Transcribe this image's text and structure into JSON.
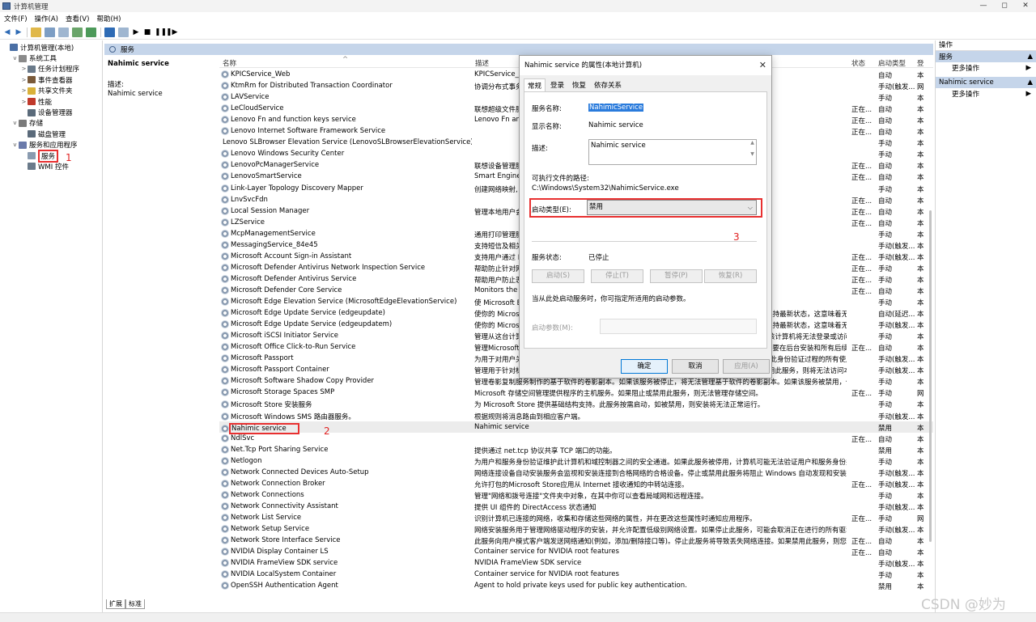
{
  "window": {
    "title": "计算机管理",
    "controls": [
      "—",
      "◻",
      "✕"
    ]
  },
  "menu": [
    "文件(F)",
    "操作(A)",
    "查看(V)",
    "帮助(H)"
  ],
  "tree": [
    {
      "label": "计算机管理(本地)",
      "level": 0,
      "exp": "",
      "color": "#4a6fa5"
    },
    {
      "label": "系统工具",
      "level": 1,
      "exp": "v",
      "color": "#8a8a8a"
    },
    {
      "label": "任务计划程序",
      "level": 2,
      "exp": ">",
      "color": "#6a7a8a"
    },
    {
      "label": "事件查看器",
      "level": 2,
      "exp": ">",
      "color": "#7a5a3a"
    },
    {
      "label": "共享文件夹",
      "level": 2,
      "exp": ">",
      "color": "#d9b13a"
    },
    {
      "label": "性能",
      "level": 2,
      "exp": ">",
      "color": "#c0392b"
    },
    {
      "label": "设备管理器",
      "level": 2,
      "exp": "",
      "color": "#5a6a7a"
    },
    {
      "label": "存储",
      "level": 1,
      "exp": "v",
      "color": "#7a7a7a"
    },
    {
      "label": "磁盘管理",
      "level": 2,
      "exp": "",
      "color": "#5a6a7a"
    },
    {
      "label": "服务和应用程序",
      "level": 1,
      "exp": "v",
      "color": "#6a7aaa"
    },
    {
      "label": "服务",
      "level": 2,
      "exp": "",
      "color": "#8a9bb0",
      "selected": true
    },
    {
      "label": "WMI 控件",
      "level": 2,
      "exp": "",
      "color": "#6a7a8a"
    }
  ],
  "annotations": {
    "a1": "1",
    "a2": "2",
    "a3": "3"
  },
  "mid": {
    "header": "服务",
    "desc_title": "Nahimic service",
    "desc_label": "描述:",
    "desc_text": "Nahimic service"
  },
  "columns": {
    "name": "名称",
    "sort": "^",
    "desc": "描述",
    "status": "状态",
    "type": "启动类型",
    "logon": "登"
  },
  "services": [
    {
      "n": "KPICService_Web",
      "d": "KPICService_W",
      "s": "",
      "t": "自动",
      "l": "本"
    },
    {
      "n": "KtmRm for Distributed Transaction Coordinator",
      "d": "协调分布式事务",
      "s": "",
      "t": "手动(触发...",
      "l": "网"
    },
    {
      "n": "LAVService",
      "d": "",
      "s": "",
      "t": "手动",
      "l": "本"
    },
    {
      "n": "LeCloudService",
      "d": "联想超级文件服",
      "s": "正在...",
      "t": "自动",
      "l": "本"
    },
    {
      "n": "Lenovo Fn and function keys service",
      "d": "Lenovo Fn and",
      "s": "正在...",
      "t": "自动",
      "l": "本"
    },
    {
      "n": "Lenovo Internet Software Framework Service",
      "d": "",
      "s": "正在...",
      "t": "自动",
      "l": "本"
    },
    {
      "n": "Lenovo SLBrowser Elevation Service (LenovoSLBrowserElevationService)",
      "d": "",
      "s": "",
      "t": "手动",
      "l": "本"
    },
    {
      "n": "Lenovo Windows Security Center",
      "d": "",
      "s": "",
      "t": "手动",
      "l": "本"
    },
    {
      "n": "LenovoPcManagerService",
      "d": "联想设备管理服",
      "s": "正在...",
      "t": "自动",
      "l": "本"
    },
    {
      "n": "LenovoSmartService",
      "d": "Smart Engine",
      "s": "正在...",
      "t": "自动",
      "l": "本"
    },
    {
      "n": "Link-Layer Topology Discovery Mapper",
      "d": "创建网络映射,",
      "s": "",
      "t": "手动",
      "l": "本"
    },
    {
      "n": "LnvSvcFdn",
      "d": "",
      "s": "正在...",
      "t": "自动",
      "l": "本"
    },
    {
      "n": "Local Session Manager",
      "d": "管理本地用户会",
      "s": "正在...",
      "t": "自动",
      "l": "本"
    },
    {
      "n": "LZService",
      "d": "",
      "s": "正在...",
      "t": "自动",
      "l": "本"
    },
    {
      "n": "McpManagementService",
      "d": "通用打印管理服",
      "s": "",
      "t": "手动",
      "l": "本"
    },
    {
      "n": "MessagingService_84e45",
      "d": "支持短信及相关",
      "s": "",
      "t": "手动(触发...",
      "l": "本"
    },
    {
      "n": "Microsoft Account Sign-in Assistant",
      "d": "支持用户通过 M",
      "s": "正在...",
      "t": "手动(触发...",
      "l": "本"
    },
    {
      "n": "Microsoft Defender Antivirus Network Inspection Service",
      "d": "帮助防止针对网",
      "s": "正在...",
      "t": "手动",
      "l": "本"
    },
    {
      "n": "Microsoft Defender Antivirus Service",
      "d": "帮助用户防止恶",
      "s": "正在...",
      "t": "手动",
      "l": "本"
    },
    {
      "n": "Microsoft Defender Core Service",
      "d": "Monitors the a",
      "s": "正在...",
      "t": "自动",
      "l": "本"
    },
    {
      "n": "Microsoft Edge Elevation Service (MicrosoftEdgeElevationService)",
      "d": "使 Microsoft E",
      "s": "",
      "t": "手动",
      "l": "本"
    },
    {
      "n": "Microsoft Edge Update Service (edgeupdate)",
      "d": "使你的 Microsoft 软件保持最新状态。如果此服务已禁用或停止，则你的 Microsoft 软件将不会保持最新状态，这意味着无法修复...",
      "s": "",
      "t": "自动(延迟...",
      "l": "本"
    },
    {
      "n": "Microsoft Edge Update Service (edgeupdatem)",
      "d": "使你的 Microsoft 软件保持最新状态。如果此服务已禁用或停止，则你的 Microsoft 软件将不会保持最新状态，这意味着无法修复...",
      "s": "",
      "t": "手动(触发...",
      "l": "本"
    },
    {
      "n": "Microsoft iSCSI Initiator Service",
      "d": "管理从这台计算机到远程 iSCSI 目标设备的 Internet SCSI (iSCSI)会话。如果该服务已停止，则该计算机将无法登录或访问 iSCS...",
      "s": "",
      "t": "手动",
      "l": "本"
    },
    {
      "n": "Microsoft Office Click-to-Run Service",
      "d": "管理Microsoft Office的资源协调、后台流、以及系统集成。此服务是必需的，因为 Office 组件需要在后台安装和所有后续更新...",
      "s": "正在...",
      "t": "自动",
      "l": "本"
    },
    {
      "n": "Microsoft Passport",
      "d": "为用于对用户关联的标识提供程序进行身份验证的加密密钥提供进程隔离。禁用此服务将阻止使用此身份验证过程的所有使用和管理将无...",
      "s": "",
      "t": "手动(触发...",
      "l": "本"
    },
    {
      "n": "Microsoft Passport Container",
      "d": "管理用于针对标识提供者以及 TPM 虚拟智能卡对用户进行身份验证的本地用户标识密钥。如果禁用此服务，则将无法访问本地...",
      "s": "",
      "t": "手动(触发...",
      "l": "本"
    },
    {
      "n": "Microsoft Software Shadow Copy Provider",
      "d": "管理卷影复制服务制作的基于软件的卷影副本。如果该服务被停止，将无法管理基于软件的卷影副本。如果该服务被禁用，任何...",
      "s": "",
      "t": "手动",
      "l": "本"
    },
    {
      "n": "Microsoft Storage Spaces SMP",
      "d": "Microsoft 存储空间管理提供程序的主机服务。如果阻止或禁用此服务，则无法管理存储空间。",
      "s": "正在...",
      "t": "手动",
      "l": "网"
    },
    {
      "n": "Microsoft Store 安装服务",
      "d": "为 Microsoft Store 提供基础结构支持。此服务按需启动，如被禁用，则安装将无法正常运行。",
      "s": "",
      "t": "手动",
      "l": "本"
    },
    {
      "n": "Microsoft Windows SMS 路由器服务。",
      "d": "根据规则将消息路由到相应客户端。",
      "s": "",
      "t": "手动(触发...",
      "l": "本"
    },
    {
      "n": "Nahimic service",
      "d": "Nahimic service",
      "s": "",
      "t": "禁用",
      "l": "本",
      "hl": true
    },
    {
      "n": "NdlSvc",
      "d": "",
      "s": "正在...",
      "t": "自动",
      "l": "本"
    },
    {
      "n": "Net.Tcp Port Sharing Service",
      "d": "提供通过 net.tcp 协议共享 TCP 端口的功能。",
      "s": "",
      "t": "禁用",
      "l": "本"
    },
    {
      "n": "Netlogon",
      "d": "为用户和服务身份验证维护此计算机和域控制器之间的安全通道。如果此服务被停用，计算机可能无法验证用户和服务身份并且...",
      "s": "",
      "t": "手动",
      "l": "本"
    },
    {
      "n": "Network Connected Devices Auto-Setup",
      "d": "网络连接设备自动安装服务会监视和安装连接到合格网络的合格设备。停止或禁用此服务将阻止 Windows 自动发现和安装合格...",
      "s": "",
      "t": "手动(触发...",
      "l": "本"
    },
    {
      "n": "Network Connection Broker",
      "d": "允许打包的Microsoft Store应用从 Internet 接收通知的中转站连接。",
      "s": "正在...",
      "t": "手动(触发...",
      "l": "本"
    },
    {
      "n": "Network Connections",
      "d": "管理\"网络和拨号连接\"文件夹中对象，在其中你可以查看局域网和远程连接。",
      "s": "",
      "t": "手动",
      "l": "本"
    },
    {
      "n": "Network Connectivity Assistant",
      "d": "提供 UI 组件的 DirectAccess 状态通知",
      "s": "",
      "t": "手动(触发...",
      "l": "本"
    },
    {
      "n": "Network List Service",
      "d": "识别计算机已连接的网络，收集和存储这些网络的属性，并在更改这些属性时通知应用程序。",
      "s": "正在...",
      "t": "手动",
      "l": "网"
    },
    {
      "n": "Network Setup Service",
      "d": "网络安装服务用于管理网络驱动程序的安装，并允许配置低级别网络设置。如果停止此服务，可能会取消正在进行的所有驱动程...",
      "s": "",
      "t": "手动(触发...",
      "l": "本"
    },
    {
      "n": "Network Store Interface Service",
      "d": "此服务向用户模式客户端发送网络通知(例如，添加/删除接口等)。停止此服务将导致丢失网络连接。如果禁用此服务，则您试图...",
      "s": "正在...",
      "t": "自动",
      "l": "本"
    },
    {
      "n": "NVIDIA Display Container LS",
      "d": "Container service for NVIDIA root features",
      "s": "正在...",
      "t": "自动",
      "l": "本"
    },
    {
      "n": "NVIDIA FrameView SDK service",
      "d": "NVIDIA FrameView SDK service",
      "s": "",
      "t": "手动(触发...",
      "l": "本"
    },
    {
      "n": "NVIDIA LocalSystem Container",
      "d": "Container service for NVIDIA root features",
      "s": "",
      "t": "手动",
      "l": "本"
    },
    {
      "n": "OpenSSH Authentication Agent",
      "d": "Agent to hold private keys used for public key authentication.",
      "s": "",
      "t": "禁用",
      "l": "本"
    }
  ],
  "bottom_tabs": [
    "扩展",
    "标准"
  ],
  "actions": {
    "header": "操作",
    "group1": "服务",
    "group2": "Nahimic service",
    "more": "更多操作"
  },
  "watermark": "CSDN @妙为",
  "dialog": {
    "title": "Nahimic service 的属性(本地计算机)",
    "close": "✕",
    "tabs": [
      "常规",
      "登录",
      "恢复",
      "依存关系"
    ],
    "svcname_label": "服务名称:",
    "svcname": "NahimicService",
    "display_label": "显示名称:",
    "display": "Nahimic service",
    "desc_label": "描述:",
    "desc": "Nahimic service",
    "path_label": "可执行文件的路径:",
    "path": "C:\\Windows\\System32\\NahimicService.exe",
    "start_label": "启动类型(E):",
    "start": "禁用",
    "status_label": "服务状态:",
    "status": "已停止",
    "btn_start": "启动(S)",
    "btn_stop": "停止(T)",
    "btn_pause": "暂停(P)",
    "btn_resume": "恢复(R)",
    "hint": "当从此处启动服务时，你可指定所适用的启动参数。",
    "param_label": "启动参数(M):",
    "ok": "确定",
    "cancel": "取消",
    "apply": "应用(A)"
  },
  "colors": {
    "accent": "#0078d7",
    "annotation": "#e83030",
    "header_blue": "#c5d5ea"
  }
}
